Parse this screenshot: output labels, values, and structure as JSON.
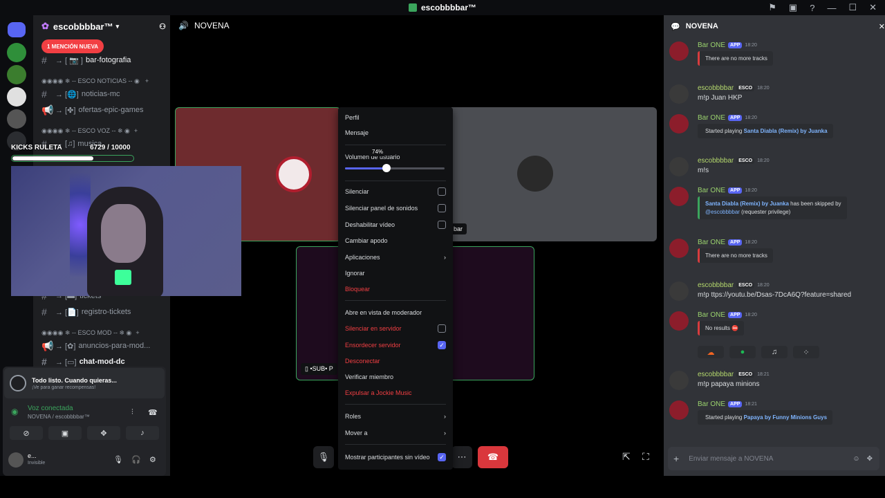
{
  "window": {
    "title": "escobbbbar™"
  },
  "server": {
    "name": "escobbbbar™"
  },
  "channels": {
    "mention_badge": "1 MENCIÓN NUEVA",
    "bar_fotografia": "bar-fotografia",
    "cat_noticias": "◉◉◉◉ ❄ -- ESCO NOTICIAS -- ◉",
    "noticias_mc": "noticias-mc",
    "ofertas": "ofertas-epic-games",
    "cat_voz": "◉◉◉◉ ❄ -- ESCO VOZ -- ❄ ◉",
    "musica": "musica",
    "tickets": "tickets",
    "registro_tickets": "registro-tickets",
    "cat_mod": "◉◉◉◉ ❄ -- ESCO MOD -- ❄ ◉",
    "anuncios_mod": "anuncios-para-mod...",
    "chat_mod": "chat-mod-dc"
  },
  "overlay": {
    "kicks_label": "KICKS RULETA",
    "kicks_value": "6729 / 10000",
    "kicks_progress": 0.6729
  },
  "voice": {
    "promo_title": "Todo listo. Cuando quieras...",
    "promo_sub": "¡Ve para ganar recompensas!",
    "status": "Voz conectada",
    "location": "NOVENA / escobbbbar™",
    "user_name": "e...",
    "user_status": "Invisible"
  },
  "stage": {
    "channel": "NOVENA",
    "tile_label_right": "bar",
    "tile_label_bottom": "•SUB• P"
  },
  "context_menu": {
    "perfil": "Perfil",
    "mensaje": "Mensaje",
    "volume_label": "Volumen de usuario",
    "volume_value": "74%",
    "volume_fraction": 0.42,
    "silenciar": "Silenciar",
    "silenciar_sonidos": "Silenciar panel de sonidos",
    "deshabilitar_video": "Deshabilitar vídeo",
    "cambiar_apodo": "Cambiar apodo",
    "aplicaciones": "Aplicaciones",
    "ignorar": "Ignorar",
    "bloquear": "Bloquear",
    "moderador": "Abre en vista de moderador",
    "silenciar_servidor": "Silenciar en servidor",
    "ensordecer_servidor": "Ensordecer servidor",
    "desconectar": "Desconectar",
    "verificar": "Verificar miembro",
    "expulsar": "Expulsar a Jockie Music",
    "roles": "Roles",
    "mover": "Mover a",
    "mostrar": "Mostrar participantes sin vídeo"
  },
  "chat": {
    "title": "NOVENA",
    "composer_placeholder": "Enviar mensaje a NOVENA",
    "bot": "Bar ONE",
    "app_tag": "APP",
    "user": "escobbbbar",
    "esco_tag": "ESCO",
    "messages": [
      {
        "time": "18:20",
        "text": "There are no more tracks"
      },
      {
        "time": "18:20",
        "text": "m!p Juan HKP"
      },
      {
        "time": "18:20",
        "prefix": "Started playing ",
        "link": "Santa Diabla (Remix) by Juanka"
      },
      {
        "time": "18:20",
        "text": "m!s"
      },
      {
        "time": "18:20",
        "link": "Santa Diabla (Remix) by Juanka",
        "suffix": " has been skipped by",
        "line2a": "@escobbbbar",
        "line2b": " (requester privilege)"
      },
      {
        "time": "18:20",
        "text": "There are no more tracks"
      },
      {
        "time": "18:20",
        "text": "m!p ttps://youtu.be/Dsas-7DcA6Q?feature=shared"
      },
      {
        "time": "18:20",
        "text": "No results"
      },
      {
        "time": "18:21",
        "text": "m!p papaya minions"
      },
      {
        "time": "18:21",
        "prefix": "Started playing ",
        "link": "Papaya by Funny Minions Guys"
      }
    ]
  }
}
